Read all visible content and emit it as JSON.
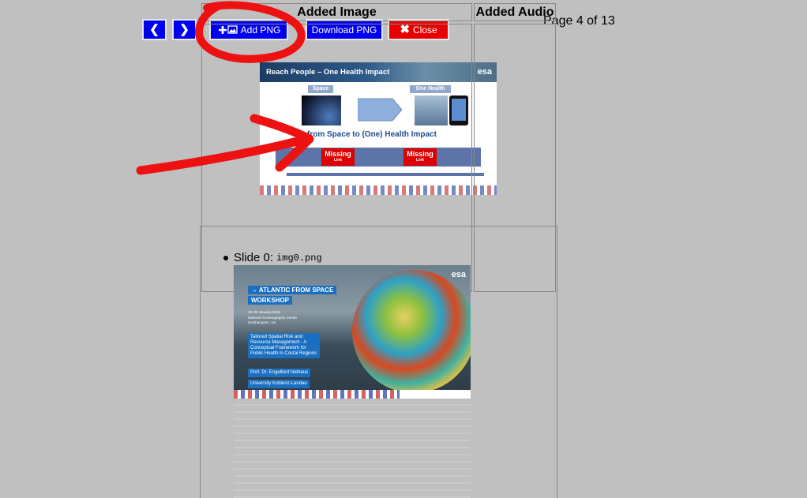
{
  "toolbar": {
    "prev_icon": "chevron-left-icon",
    "next_icon": "chevron-right-icon",
    "add_png_label": "Add PNG",
    "add_png_icon": "plus-image-icon",
    "download_png_label": "Download PNG",
    "close_label": "Close",
    "close_icon": "close-icon",
    "accent_color": "#0000ee",
    "close_color": "#e80000"
  },
  "page_indicator": "Page 4 of 13",
  "preview_slide": {
    "header_title": "Reach People – One Health Impact",
    "logo_text": "esa",
    "label_space": "Space",
    "label_one_health": "One Health",
    "subtitle": "from Space to (One) Health Impact",
    "missing_label": "Missing",
    "missing_sublabel": "Link"
  },
  "table": {
    "headers": [
      "Added Image",
      "Added Audio"
    ],
    "items": [
      {
        "prefix": "Slide 0:",
        "filename": "img0.png"
      }
    ]
  },
  "thumbnail_slide": {
    "logo_text": "esa",
    "title_line1": "→ ATLANTIC FROM SPACE",
    "title_line2": "WORKSHOP",
    "date_line": "23–25 January 2019",
    "venue_line1": "National Oceanography Centre",
    "venue_line2": "Southampton, UK",
    "talk_title": "Tailored Spatial Risk and Resource Management - A Conceptual Framework for Public Health in Costal Regions",
    "speaker": "Prof. Dr. Engelbert Niehaus",
    "affiliation": "University Koblenz-Landau"
  },
  "annotation_color": "#ee1111"
}
